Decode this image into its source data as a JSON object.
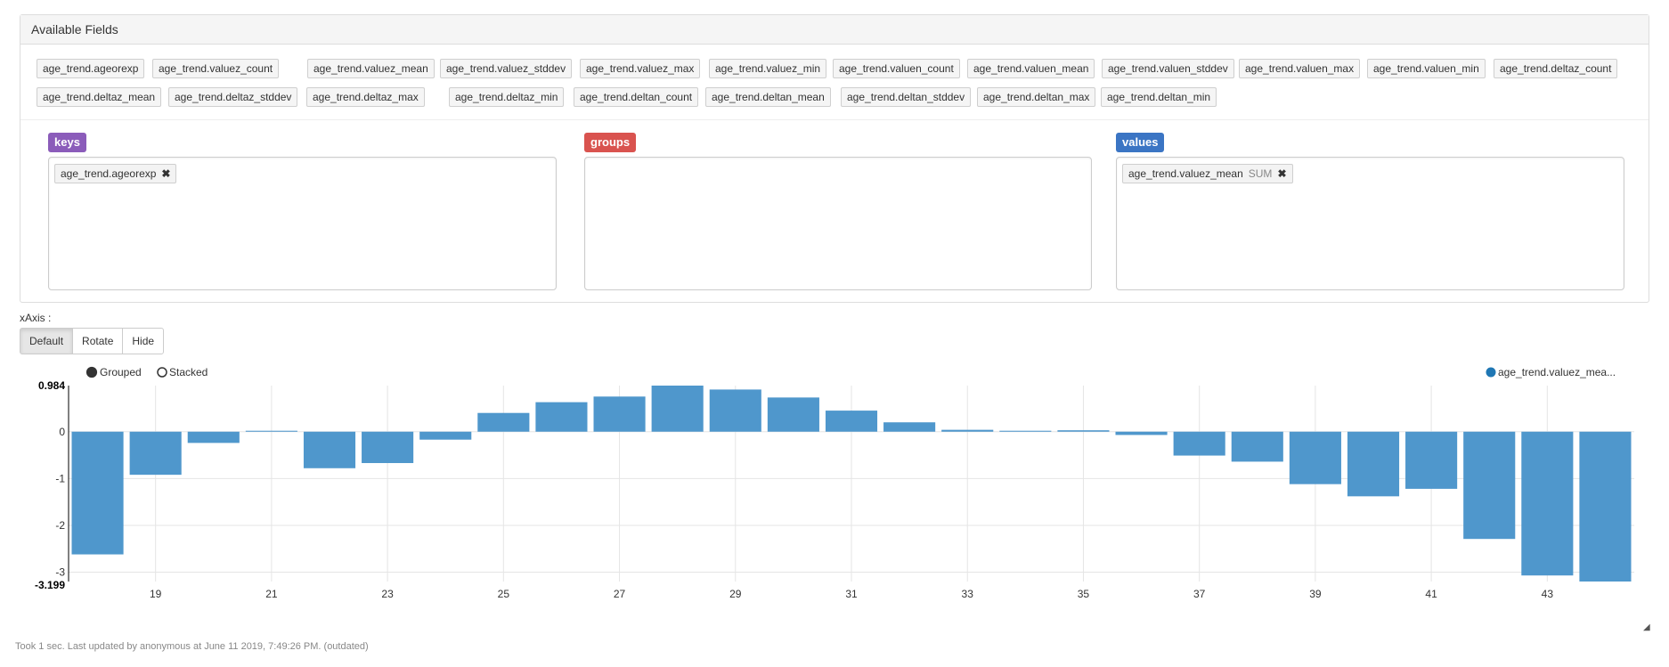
{
  "panel": {
    "title": "Available Fields",
    "fields": [
      "age_trend.ageorexp",
      "age_trend.valuez_count",
      "age_trend.valuez_mean",
      "age_trend.valuez_stddev",
      "age_trend.valuez_max",
      "age_trend.valuez_min",
      "age_trend.valuen_count",
      "age_trend.valuen_mean",
      "age_trend.valuen_stddev",
      "age_trend.valuen_max",
      "age_trend.valuen_min",
      "age_trend.deltaz_count",
      "age_trend.deltaz_mean",
      "age_trend.deltaz_stddev",
      "age_trend.deltaz_max",
      "age_trend.deltaz_min",
      "age_trend.deltan_count",
      "age_trend.deltan_mean",
      "age_trend.deltan_stddev",
      "age_trend.deltan_max",
      "age_trend.deltan_min"
    ],
    "keys": {
      "label": "keys",
      "color": "#8b5cba",
      "items": [
        {
          "text": "age_trend.ageorexp",
          "remove": "✖"
        }
      ]
    },
    "groups": {
      "label": "groups",
      "color": "#d9534f",
      "items": []
    },
    "values": {
      "label": "values",
      "color": "#3b75c4",
      "items": [
        {
          "text": "age_trend.valuez_mean",
          "agg": "SUM",
          "remove": "✖"
        }
      ]
    }
  },
  "xaxis": {
    "label": "xAxis :",
    "buttons": [
      "Default",
      "Rotate",
      "Hide"
    ],
    "active": "Default"
  },
  "chart_data": {
    "type": "bar",
    "mode_options": [
      {
        "label": "Grouped",
        "selected": true
      },
      {
        "label": "Stacked",
        "selected": false
      }
    ],
    "legend": "age_trend.valuez_mea...",
    "bar_color": "#4f97cc",
    "x": [
      18,
      19,
      20,
      21,
      22,
      23,
      24,
      25,
      26,
      27,
      28,
      29,
      30,
      31,
      32,
      33,
      34,
      35,
      36,
      37,
      38,
      39,
      40,
      41,
      42,
      43,
      44
    ],
    "values": [
      -2.62,
      -0.92,
      -0.24,
      0.02,
      -0.78,
      -0.67,
      -0.17,
      0.4,
      0.63,
      0.75,
      0.984,
      0.9,
      0.73,
      0.45,
      0.2,
      0.04,
      0.02,
      0.03,
      -0.07,
      -0.51,
      -0.64,
      -1.12,
      -1.38,
      -1.22,
      -2.29,
      -3.07,
      -3.199
    ],
    "x_ticks": [
      "19",
      "21",
      "23",
      "25",
      "27",
      "29",
      "31",
      "33",
      "35",
      "37",
      "39",
      "41",
      "43"
    ],
    "y_ticks": [
      "0",
      "-1",
      "-2",
      "-3"
    ],
    "y_max_label": "0.984",
    "y_min_label": "-3.199",
    "ylim": [
      -3.199,
      0.984
    ]
  },
  "status": "Took 1 sec. Last updated by anonymous at June 11 2019, 7:49:26 PM. (outdated)",
  "resize_icon": "◢"
}
